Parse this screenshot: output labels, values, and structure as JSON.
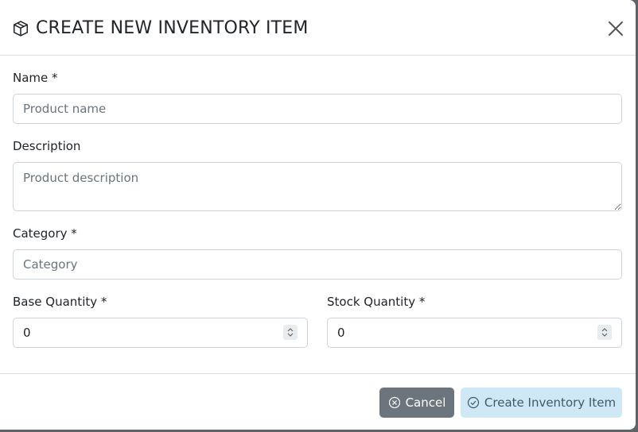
{
  "modal": {
    "title": "CREATE NEW INVENTORY ITEM",
    "header_icon": "box-icon",
    "close_icon": "close-icon"
  },
  "form": {
    "name": {
      "label": "Name *",
      "placeholder": "Product name",
      "value": ""
    },
    "description": {
      "label": "Description",
      "placeholder": "Product description",
      "value": ""
    },
    "category": {
      "label": "Category *",
      "placeholder": "Category",
      "value": ""
    },
    "base_quantity": {
      "label": "Base Quantity *",
      "value": "0"
    },
    "stock_quantity": {
      "label": "Stock Quantity *",
      "value": "0"
    }
  },
  "footer": {
    "cancel_label": "Cancel",
    "cancel_icon": "x-circle-icon",
    "create_label": "Create Inventory Item",
    "create_icon": "check-circle-icon"
  },
  "colors": {
    "cancel_bg": "#6c757d",
    "create_bg": "#cfe8f6",
    "border": "#ced4da"
  }
}
